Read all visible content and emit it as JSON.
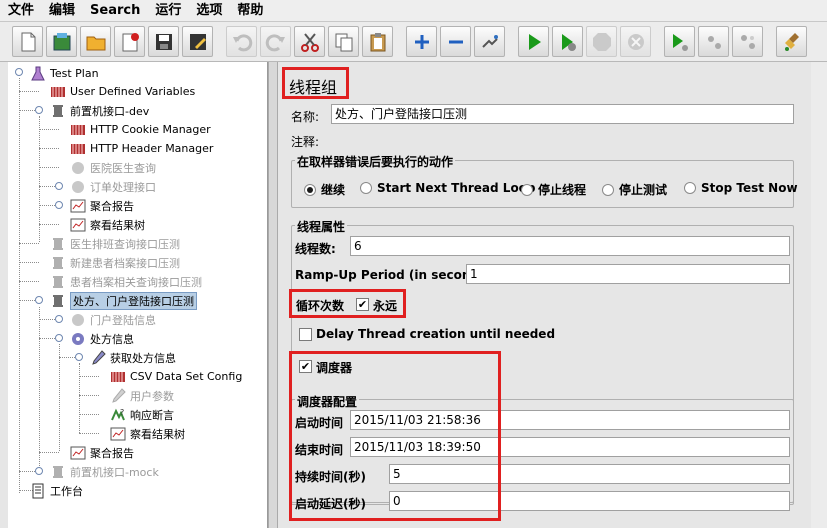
{
  "menu": [
    "文件",
    "编辑",
    "Search",
    "运行",
    "选项",
    "帮助"
  ],
  "tree": {
    "test_plan": "Test Plan",
    "user_defined_variables": "User Defined Variables",
    "prefix_dev": "前置机接口-dev",
    "cookie_manager": "HTTP Cookie Manager",
    "header_manager": "HTTP Header Manager",
    "hospital_query": "医院医生查询",
    "order_process": "订单处理接口",
    "aggregate_report": "聚合报告",
    "view_results_tree": "察看结果树",
    "doctor_shift": "医生排班查询接口压测",
    "new_patient": "新建患者档案接口压测",
    "patient_record": "患者档案相关查询接口压测",
    "rx_login": "处方、门户登陆接口压测",
    "portal_login_info": "门户登陆信息",
    "rx_info": "处方信息",
    "get_rx_info": "获取处方信息",
    "csv_config": "CSV Data Set Config",
    "user_params": "用户参数",
    "response_assert": "响应断言",
    "view_results_tree2": "察看结果树",
    "aggregate_report2": "聚合报告",
    "prefix_mock": "前置机接口-mock",
    "workbench": "工作台"
  },
  "panel": {
    "title": "线程组",
    "name_label": "名称:",
    "name_value": "处方、门户登陆接口压测",
    "comment_label": "注释:",
    "comment_value": "",
    "error_group_label": "在取样器错误后要执行的动作",
    "actions": {
      "continue": "继续",
      "start_next": "Start Next Thread Loop",
      "stop_thread": "停止线程",
      "stop_test": "停止测试",
      "stop_now": "Stop Test Now"
    },
    "thread_props_label": "线程属性",
    "threads_label": "线程数:",
    "threads_value": "6",
    "rampup_label": "Ramp-Up Period (in seconds):",
    "rampup_value": "1",
    "loop_label": "循环次数",
    "forever_label": "永远",
    "delay_label": "Delay Thread creation until needed",
    "scheduler_label": "调度器",
    "scheduler_config_label": "调度器配置",
    "start_time_label": "启动时间",
    "start_time_value": "2015/11/03 21:58:36",
    "end_time_label": "结束时间",
    "end_time_value": "2015/11/03 18:39:50",
    "duration_label": "持续时间(秒)",
    "duration_value": "5",
    "startup_delay_label": "启动延迟(秒)",
    "startup_delay_value": "0"
  }
}
